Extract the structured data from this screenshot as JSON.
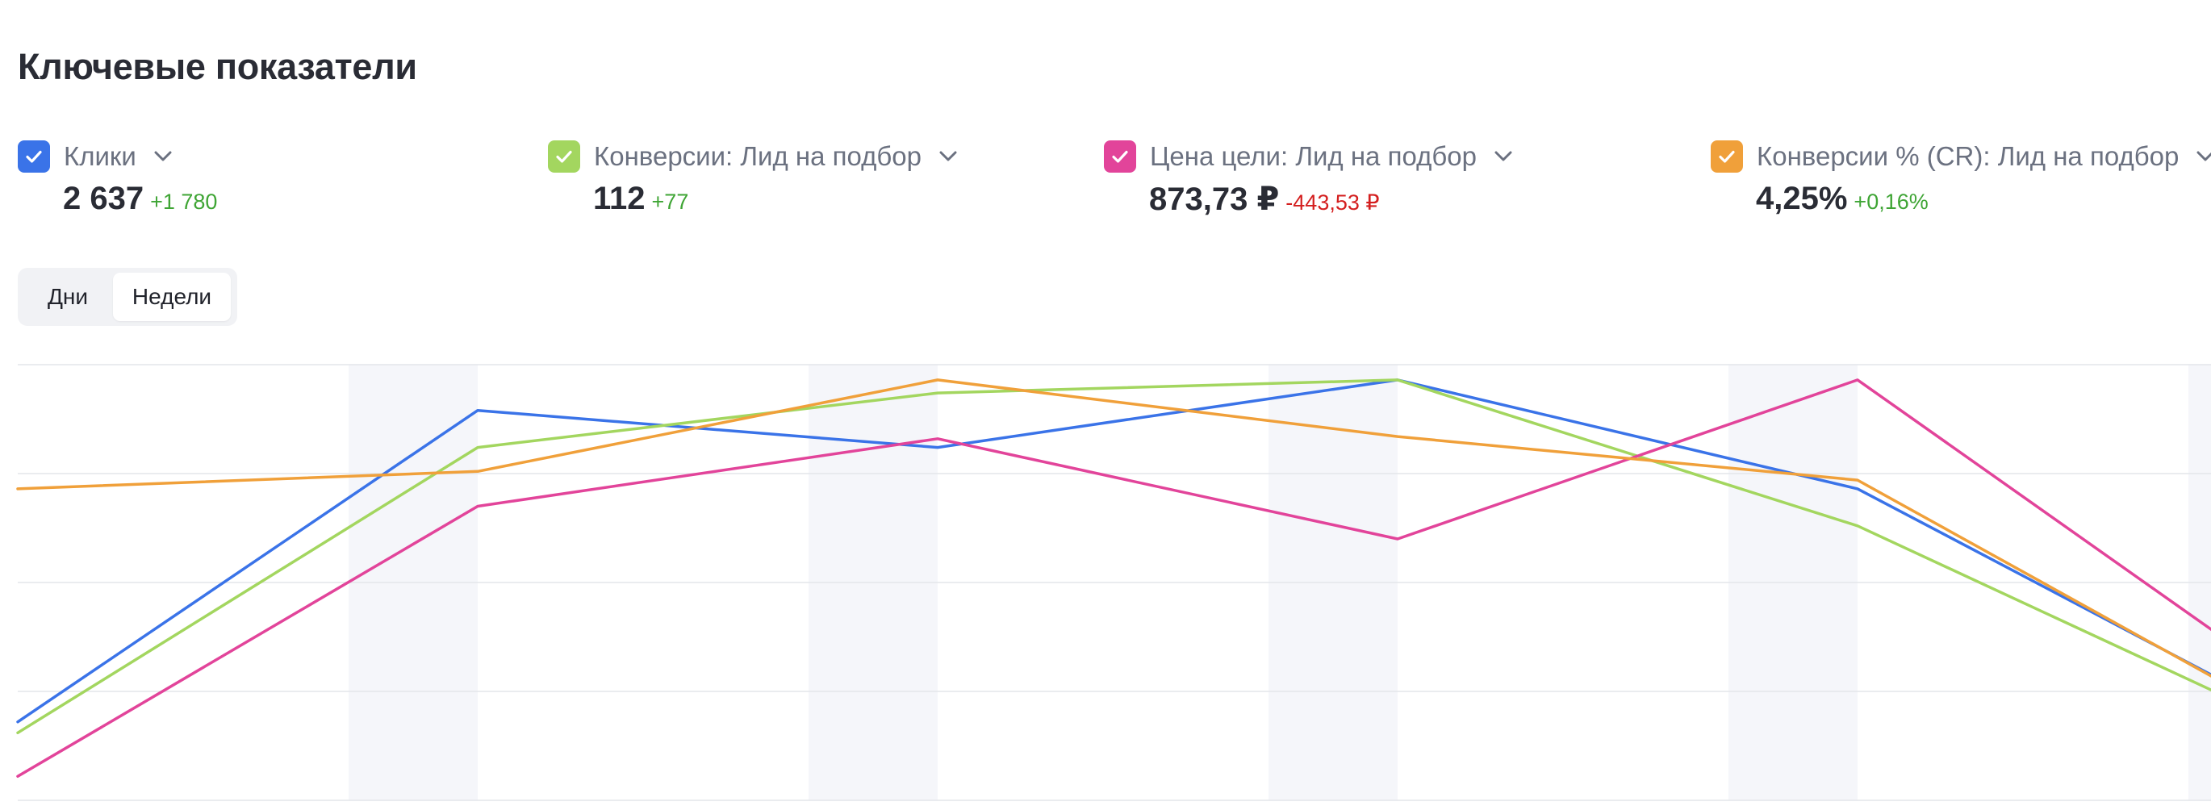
{
  "header": {
    "title": "Ключевые показатели"
  },
  "metrics": [
    {
      "label": "Клики",
      "value": "2 637",
      "delta": "+1 780",
      "delta_sign": "positive",
      "color": "#3a73e8",
      "checked": true,
      "icon": "chevron-down-icon"
    },
    {
      "label": "Конверсии: Лид на подбор",
      "value": "112",
      "delta": "+77",
      "delta_sign": "positive",
      "color": "#a3d65f",
      "checked": true,
      "icon": "chevron-down-icon"
    },
    {
      "label": "Цена цели: Лид на подбор",
      "value": "873,73 ₽",
      "delta": "-443,53 ₽",
      "delta_sign": "negative",
      "color": "#e2449a",
      "checked": true,
      "icon": "chevron-down-icon"
    },
    {
      "label": "Конверсии % (CR): Лид на подбор",
      "value": "4,25%",
      "delta": "+0,16%",
      "delta_sign": "positive",
      "color": "#f0a03a",
      "checked": true,
      "icon": "chevron-down-icon"
    }
  ],
  "period_toggle": {
    "options": [
      "Дни",
      "Недели"
    ],
    "selected": "Недели"
  },
  "chart_data": {
    "type": "line",
    "title": "",
    "xlabel": "",
    "ylabel": "",
    "x_count": 6,
    "ylim": [
      0,
      100
    ],
    "grid": true,
    "legend": "none",
    "shaded_alternate_columns": true,
    "series": [
      {
        "color": "#3a73e8",
        "values": [
          18,
          89.5,
          81,
          96.5,
          71.5,
          16
        ]
      },
      {
        "color": "#a3d65f",
        "values": [
          15.5,
          81,
          93.5,
          96.5,
          63,
          14
        ]
      },
      {
        "color": "#e2449a",
        "values": [
          5.5,
          67.5,
          83,
          60,
          96.5,
          22
        ]
      },
      {
        "color": "#f0a03a",
        "values": [
          71.5,
          75.5,
          96.5,
          83.5,
          73.5,
          15
        ]
      }
    ]
  }
}
